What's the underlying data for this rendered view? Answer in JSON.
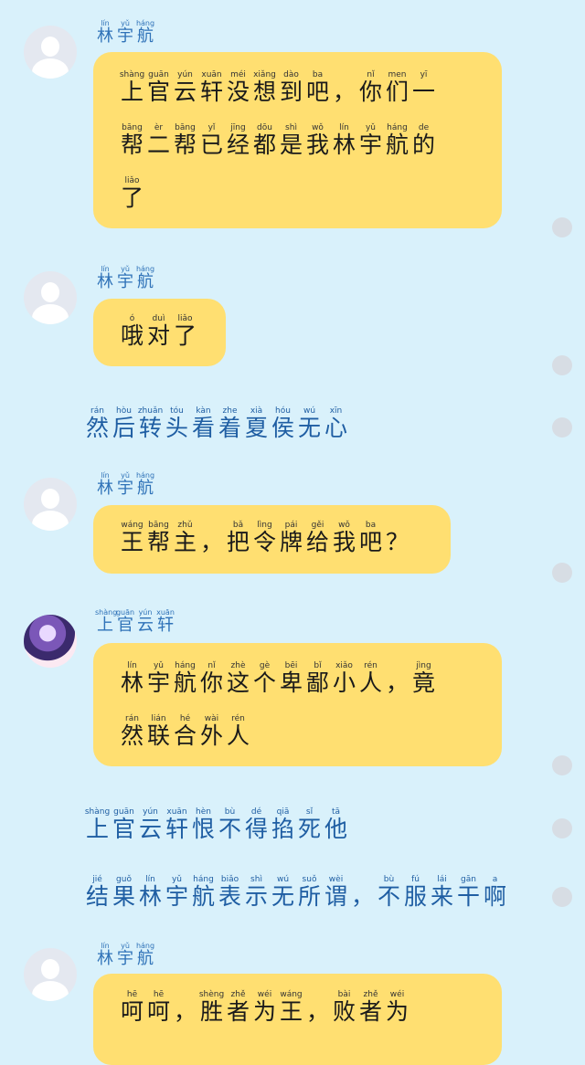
{
  "messages": [
    {
      "speaker_pinyin": [
        "lín",
        "yǔ",
        "háng"
      ],
      "speaker": [
        "林",
        "宇",
        "航"
      ],
      "lines": [
        {
          "py": [
            "shàng",
            "guān",
            "yún",
            "xuān",
            "méi",
            "xiǎng",
            "dào",
            "ba",
            "",
            "nǐ",
            "men",
            "yī"
          ],
          "hz": [
            "上",
            "官",
            "云",
            "轩",
            "没",
            "想",
            "到",
            "吧",
            "，",
            "你",
            "们",
            "一"
          ]
        },
        {
          "py": [
            "bāng",
            "èr",
            "bāng",
            "yǐ",
            "jīng",
            "dōu",
            "shì",
            "wǒ",
            "lín",
            "yǔ",
            "háng",
            "de"
          ],
          "hz": [
            "帮",
            "二",
            "帮",
            "已",
            "经",
            "都",
            "是",
            "我",
            "林",
            "宇",
            "航",
            "的"
          ]
        },
        {
          "py": [
            "liǎo"
          ],
          "hz": [
            "了"
          ]
        }
      ]
    },
    {
      "speaker_pinyin": [
        "lín",
        "yǔ",
        "háng"
      ],
      "speaker": [
        "林",
        "宇",
        "航"
      ],
      "lines": [
        {
          "py": [
            "ó",
            "duì",
            "liǎo"
          ],
          "hz": [
            "哦",
            "对",
            "了"
          ]
        }
      ]
    },
    {
      "narration": {
        "py": [
          "rán",
          "hòu",
          "zhuǎn",
          "tóu",
          "kàn",
          "zhe",
          "xià",
          "hóu",
          "wú",
          "xīn"
        ],
        "hz": [
          "然",
          "后",
          "转",
          "头",
          "看",
          "着",
          "夏",
          "侯",
          "无",
          "心"
        ]
      }
    },
    {
      "speaker_pinyin": [
        "lín",
        "yǔ",
        "háng"
      ],
      "speaker": [
        "林",
        "宇",
        "航"
      ],
      "lines": [
        {
          "py": [
            "wáng",
            "bāng",
            "zhǔ",
            "",
            "bǎ",
            "lìng",
            "pái",
            "gěi",
            "wǒ",
            "ba",
            ""
          ],
          "hz": [
            "王",
            "帮",
            "主",
            "，",
            "把",
            "令",
            "牌",
            "给",
            "我",
            "吧",
            "？"
          ]
        }
      ]
    },
    {
      "speaker_pinyin": [
        "shàng",
        "guān",
        "yún",
        "xuān"
      ],
      "speaker": [
        "上",
        "官",
        "云",
        "轩"
      ],
      "lines": [
        {
          "py": [
            "lín",
            "yǔ",
            "háng",
            "nǐ",
            "zhè",
            "gè",
            "bēi",
            "bǐ",
            "xiǎo",
            "rén",
            "",
            "jìng"
          ],
          "hz": [
            "林",
            "宇",
            "航",
            "你",
            "这",
            "个",
            "卑",
            "鄙",
            "小",
            "人",
            "，",
            "竟"
          ]
        },
        {
          "py": [
            "rán",
            "lián",
            "hé",
            "wài",
            "rén"
          ],
          "hz": [
            "然",
            "联",
            "合",
            "外",
            "人"
          ]
        }
      ]
    },
    {
      "narration": {
        "py": [
          "shàng",
          "guān",
          "yún",
          "xuān",
          "hèn",
          "bù",
          "dé",
          "qiā",
          "sǐ",
          "tā"
        ],
        "hz": [
          "上",
          "官",
          "云",
          "轩",
          "恨",
          "不",
          "得",
          "掐",
          "死",
          "他"
        ]
      }
    },
    {
      "narration": {
        "py": [
          "jié",
          "guǒ",
          "lín",
          "yǔ",
          "háng",
          "biǎo",
          "shì",
          "wú",
          "suǒ",
          "wèi",
          "",
          "bù",
          "fú",
          "lái",
          "gān",
          "a"
        ],
        "hz": [
          "结",
          "果",
          "林",
          "宇",
          "航",
          "表",
          "示",
          "无",
          "所",
          "谓",
          "，",
          "不",
          "服",
          "来",
          "干",
          "啊"
        ]
      }
    },
    {
      "speaker_pinyin": [
        "lín",
        "yǔ",
        "háng"
      ],
      "speaker": [
        "林",
        "宇",
        "航"
      ],
      "lines": [
        {
          "py": [
            "hē",
            "hē",
            "",
            "shèng",
            "zhě",
            "wéi",
            "wáng",
            "",
            "bài",
            "zhě",
            "wéi"
          ],
          "hz": [
            "呵",
            "呵",
            "，",
            "胜",
            "者",
            "为",
            "王",
            "，",
            "败",
            "者",
            "为"
          ]
        }
      ]
    }
  ]
}
